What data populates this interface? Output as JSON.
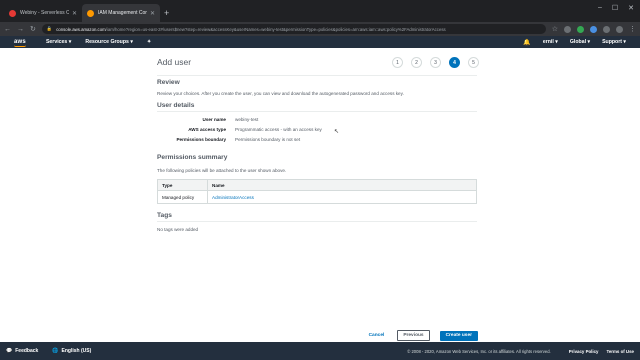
{
  "browser": {
    "tabs": [
      {
        "title": "Webiny - Serverless CMS powe...",
        "active": false,
        "favicon_color": "#e53935"
      },
      {
        "title": "IAM Management Console",
        "active": true,
        "favicon_color": "#ff9900"
      }
    ],
    "new_tab": "+",
    "url_host": "console.aws.amazon.com",
    "url_rest": "/iam/home?region=us-east-2#/users$new?step=review&accessKey&userNames=webiny-test&permissionType=policies&policies=arn:aws:iam::aws:policy%2FAdministratorAccess"
  },
  "aws_nav": {
    "logo": "aws",
    "services": "Services",
    "resource_groups": "Resource Groups",
    "account": "ernil",
    "region": "Global",
    "support": "Support"
  },
  "page": {
    "title": "Add user",
    "steps": [
      "1",
      "2",
      "3",
      "4",
      "5"
    ],
    "current_step": "4",
    "review_heading": "Review",
    "review_desc": "Review your choices. After you create the user, you can view and download the autogenerated password and access key.",
    "user_details_heading": "User details",
    "details": [
      {
        "key": "User name",
        "value": "webiny-test"
      },
      {
        "key": "AWS access type",
        "value": "Programmatic access - with an access key"
      },
      {
        "key": "Permissions boundary",
        "value": "Permissions boundary is not set"
      }
    ],
    "permissions_heading": "Permissions summary",
    "permissions_desc": "The following policies will be attached to the user shown above.",
    "table": {
      "headers": [
        "Type",
        "Name"
      ],
      "rows": [
        {
          "type": "Managed policy",
          "name": "AdministratorAccess"
        }
      ]
    },
    "tags_heading": "Tags",
    "tags_desc": "No tags were added",
    "cancel": "Cancel",
    "previous": "Previous",
    "create": "Create user"
  },
  "footer": {
    "feedback": "Feedback",
    "language": "English (US)",
    "copyright": "© 2008 - 2020, Amazon Web Services, Inc. or its affiliates. All rights reserved.",
    "privacy": "Privacy Policy",
    "terms": "Terms of Use"
  }
}
